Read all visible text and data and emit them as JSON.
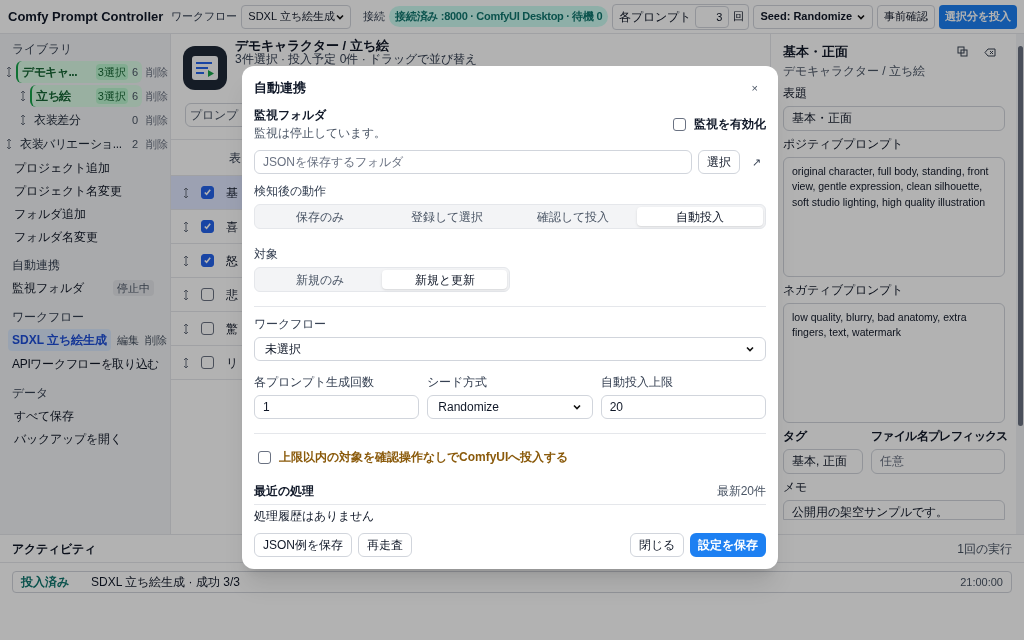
{
  "header": {
    "app_title": "Comfy Prompt Controller",
    "workflow_label": "ワークフロー",
    "workflow_value": "SDXL 立ち絵生成",
    "connection_label": "接続",
    "connection_status": "接続済み :8000 · ComfyUI Desktop · 待機 0",
    "per_prompt_label": "各プロンプト",
    "per_prompt_value": "3",
    "per_prompt_unit": "回",
    "seed_value": "Seed: Randomize",
    "preview_button": "事前確認",
    "submit_button": "選択分を投入"
  },
  "sidebar": {
    "library_heading": "ライブラリ",
    "tree": [
      {
        "label": "デモキャ...",
        "badge": "3選択",
        "count": "6",
        "action": "削除",
        "selected": true,
        "children": [
          {
            "label": "立ち絵",
            "badge": "3選択",
            "count": "6",
            "action": "削除",
            "selected": true
          },
          {
            "label": "衣装差分",
            "count": "0",
            "action": "削除",
            "selected": false
          }
        ]
      },
      {
        "label": "衣装バリエーショ...",
        "count": "2",
        "action": "削除",
        "selected": false
      }
    ],
    "library_actions": [
      "プロジェクト追加",
      "プロジェクト名変更",
      "フォルダ追加",
      "フォルダ名変更"
    ],
    "auto_heading": "自動連携",
    "watch_item": {
      "label": "監視フォルダ",
      "status": "停止中"
    },
    "workflow_heading": "ワークフロー",
    "workflow_item": {
      "label": "SDXL 立ち絵生成",
      "edit": "編集",
      "delete": "削除",
      "selected": true
    },
    "import_item": "APIワークフローを取り込む",
    "data_heading": "データ",
    "data_actions": [
      "すべて保存",
      "バックアップを開く"
    ]
  },
  "main": {
    "title": "デモキャラクター / 立ち絵",
    "subtitle": "3件選択 · 投入予定 0件 · ドラッグで並び替え",
    "search_placeholder": "プロンプ",
    "column_1": "表",
    "rows": [
      {
        "text": "基",
        "checked": true,
        "selected": true
      },
      {
        "text": "喜",
        "checked": true,
        "selected": false
      },
      {
        "text": "怒",
        "checked": true,
        "selected": false
      },
      {
        "text": "悲",
        "checked": false,
        "selected": false
      },
      {
        "text": "驚",
        "checked": false,
        "selected": false
      },
      {
        "text": "リ",
        "checked": false,
        "selected": false
      }
    ]
  },
  "detail": {
    "title": "基本・正面",
    "subtitle": "デモキャラクター / 立ち絵",
    "title_label": "表題",
    "title_value": "基本・正面",
    "positive_label": "ポジティブプロンプト",
    "positive_value": "original character, full body, standing, front view, gentle expression, clean silhouette, soft studio lighting, high quality illustration",
    "negative_label": "ネガティブプロンプト",
    "negative_value": "low quality, blurry, bad anatomy, extra fingers, text, watermark",
    "tag_label": "タグ",
    "tag_value": "基本, 正面",
    "prefix_label": "ファイル名プレフィックス",
    "prefix_placeholder": "任意",
    "memo_label": "メモ",
    "memo_value": "公開用の架空サンプルです。"
  },
  "activity": {
    "title": "アクティビティ",
    "summary": "1回の実行",
    "entries": [
      {
        "status": "投入済み",
        "text": "SDXL 立ち絵生成 · 成功 3/3",
        "time": "21:00:00"
      }
    ]
  },
  "dialog": {
    "title": "自動連携",
    "close": "×",
    "watch_heading": "監視フォルダ",
    "watch_status": "監視は停止しています。",
    "enable_label": "監視を有効化",
    "enable_checked": false,
    "folder_placeholder": "JSONを保存するフォルダ",
    "choose_button": "選択",
    "open_icon": "↗",
    "action_label": "検知後の動作",
    "actions": [
      {
        "label": "保存のみ",
        "selected": false
      },
      {
        "label": "登録して選択",
        "selected": false
      },
      {
        "label": "確認して投入",
        "selected": false
      },
      {
        "label": "自動投入",
        "selected": true
      }
    ],
    "target_label": "対象",
    "targets": [
      {
        "label": "新規のみ",
        "selected": false
      },
      {
        "label": "新規と更新",
        "selected": true
      }
    ],
    "workflow_label": "ワークフロー",
    "workflow_value": "未選択",
    "count_label": "各プロンプト生成回数",
    "count_value": "1",
    "seed_label": "シード方式",
    "seed_value": "Randomize",
    "limit_label": "自動投入上限",
    "limit_value": "20",
    "confirm_label": "上限以内の対象を確認操作なしでComfyUIへ投入する",
    "confirm_checked": false,
    "recent_heading": "最近の処理",
    "recent_note": "最新20件",
    "recent_empty": "処理履歴はありません",
    "buttons": {
      "sample": "JSON例を保存",
      "rescan": "再走査",
      "close": "閉じる",
      "save": "設定を保存"
    }
  }
}
